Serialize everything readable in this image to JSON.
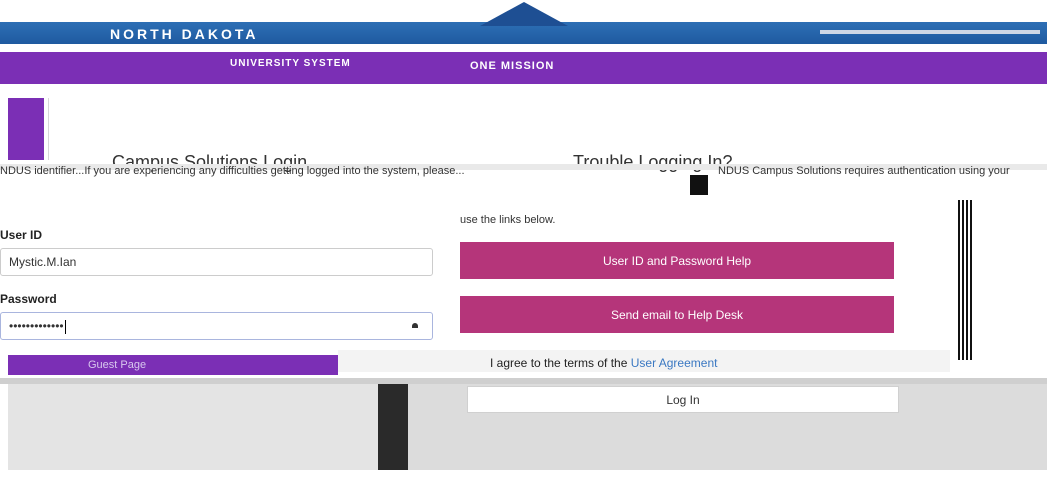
{
  "header": {
    "brand": "NORTH DAKOTA",
    "brand_sub": "UNIVERSITY SYSTEM",
    "system_name": "ONE MISSION"
  },
  "left": {
    "heading": "Campus Solutions Login",
    "info": "NDUS identifier...If you are experiencing any difficulties getting logged into the system, please...",
    "user_id_label": "User ID",
    "user_id_value": "Mystic.M.Ian",
    "password_label": "Password",
    "password_value": "•••••••••••••"
  },
  "right": {
    "heading": "Trouble Logging In?",
    "info": "NDUS Campus Solutions requires authentication using your",
    "use_links": "use the links below.",
    "btn_help": "User ID and Password Help",
    "btn_email": "Send email to Help Desk"
  },
  "guest_page": "Guest Page",
  "agreement": {
    "text": "I agree to the terms of the ",
    "link": "User Agreement"
  },
  "login_button": "Log In"
}
